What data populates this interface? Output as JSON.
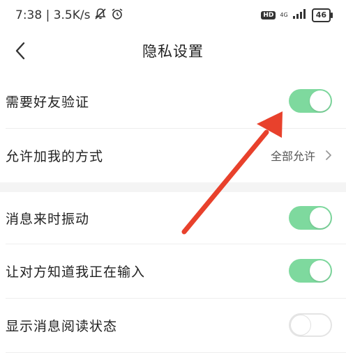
{
  "status_bar": {
    "time_speed": "7:38 | 3.5K/s",
    "network_hd": "HD",
    "network_type": "4G",
    "battery": "46"
  },
  "nav": {
    "title": "隐私设置"
  },
  "settings": [
    {
      "label": "需要好友验证",
      "type": "toggle",
      "on": true
    },
    {
      "label": "允许加我的方式",
      "type": "link",
      "value": "全部允许"
    },
    {
      "label": "消息来时振动",
      "type": "toggle",
      "on": true
    },
    {
      "label": "让对方知道我正在输入",
      "type": "toggle",
      "on": true
    },
    {
      "label": "显示消息阅读状态",
      "type": "toggle",
      "on": false
    }
  ],
  "colors": {
    "toggle_on": "#7ed99e",
    "arrow": "#e8412c"
  }
}
